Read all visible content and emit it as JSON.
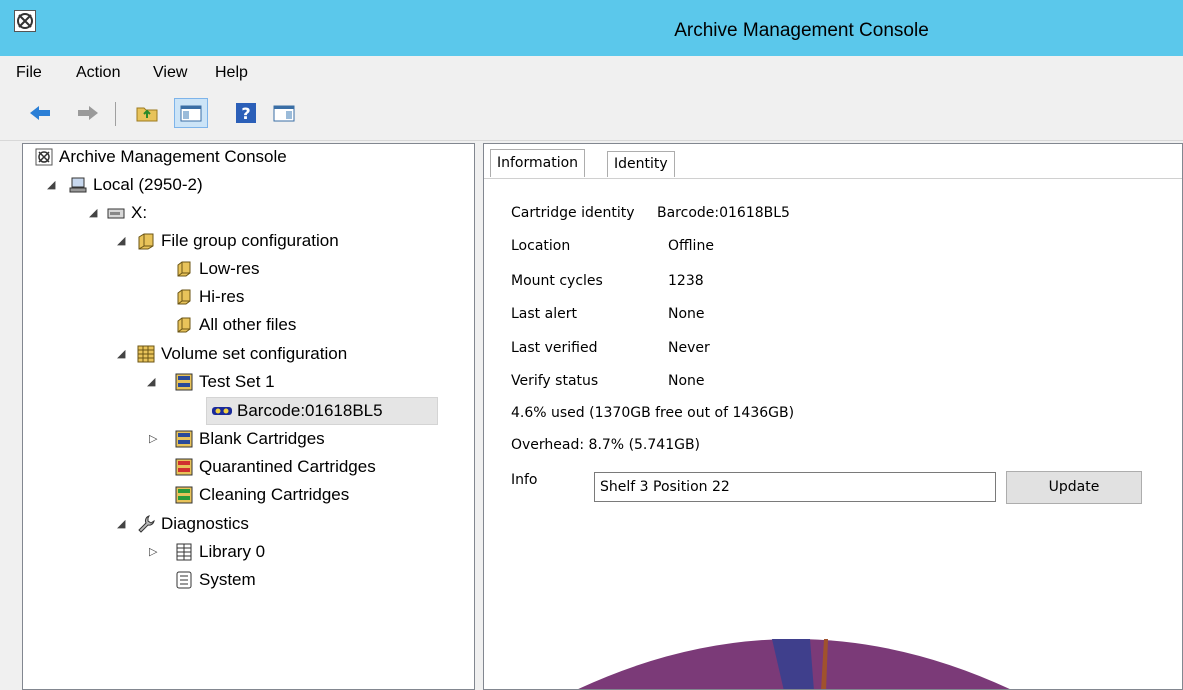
{
  "window": {
    "title": "Archive Management Console"
  },
  "menu": {
    "items": [
      "File",
      "Action",
      "View",
      "Help"
    ]
  },
  "toolbar": {
    "buttons": [
      "back-arrow",
      "forward-arrow",
      "up-folder",
      "show-hide-tree",
      "help",
      "action-pane"
    ]
  },
  "tree": {
    "root": "Archive Management Console",
    "local": "Local (2950-2)",
    "drive": "X:",
    "file_group": "File group configuration",
    "low_res": "Low-res",
    "hi_res": "Hi-res",
    "all_other": "All other files",
    "volume_set": "Volume set configuration",
    "test_set": "Test Set 1",
    "barcode": "Barcode:01618BL5",
    "blank": "Blank Cartridges",
    "quarantined": "Quarantined Cartridges",
    "cleaning": "Cleaning Cartridges",
    "diagnostics": "Diagnostics",
    "library": "Library 0",
    "system": "System"
  },
  "tabs": {
    "information": "Information",
    "identity": "Identity"
  },
  "details": {
    "cartridge_identity_label": "Cartridge identity",
    "cartridge_identity_value": "Barcode:01618BL5",
    "location_label": "Location",
    "location_value": "Offline",
    "mount_cycles_label": "Mount cycles",
    "mount_cycles_value": "1238",
    "last_alert_label": "Last alert",
    "last_alert_value": "None",
    "last_verified_label": "Last verified",
    "last_verified_value": "Never",
    "verify_status_label": "Verify status",
    "verify_status_value": "None",
    "usage": "4.6% used (1370GB free out of 1436GB)",
    "overhead": "Overhead: 8.7% (5.741GB)",
    "info_label": "Info",
    "info_value": "Shelf 3 Position 22",
    "update_label": "Update"
  },
  "colors": {
    "titlebar": "#5bc8eb",
    "pie_main": "#7b3a78",
    "pie_used": "#3f3f8c",
    "pie_overhead": "#a0522d"
  }
}
